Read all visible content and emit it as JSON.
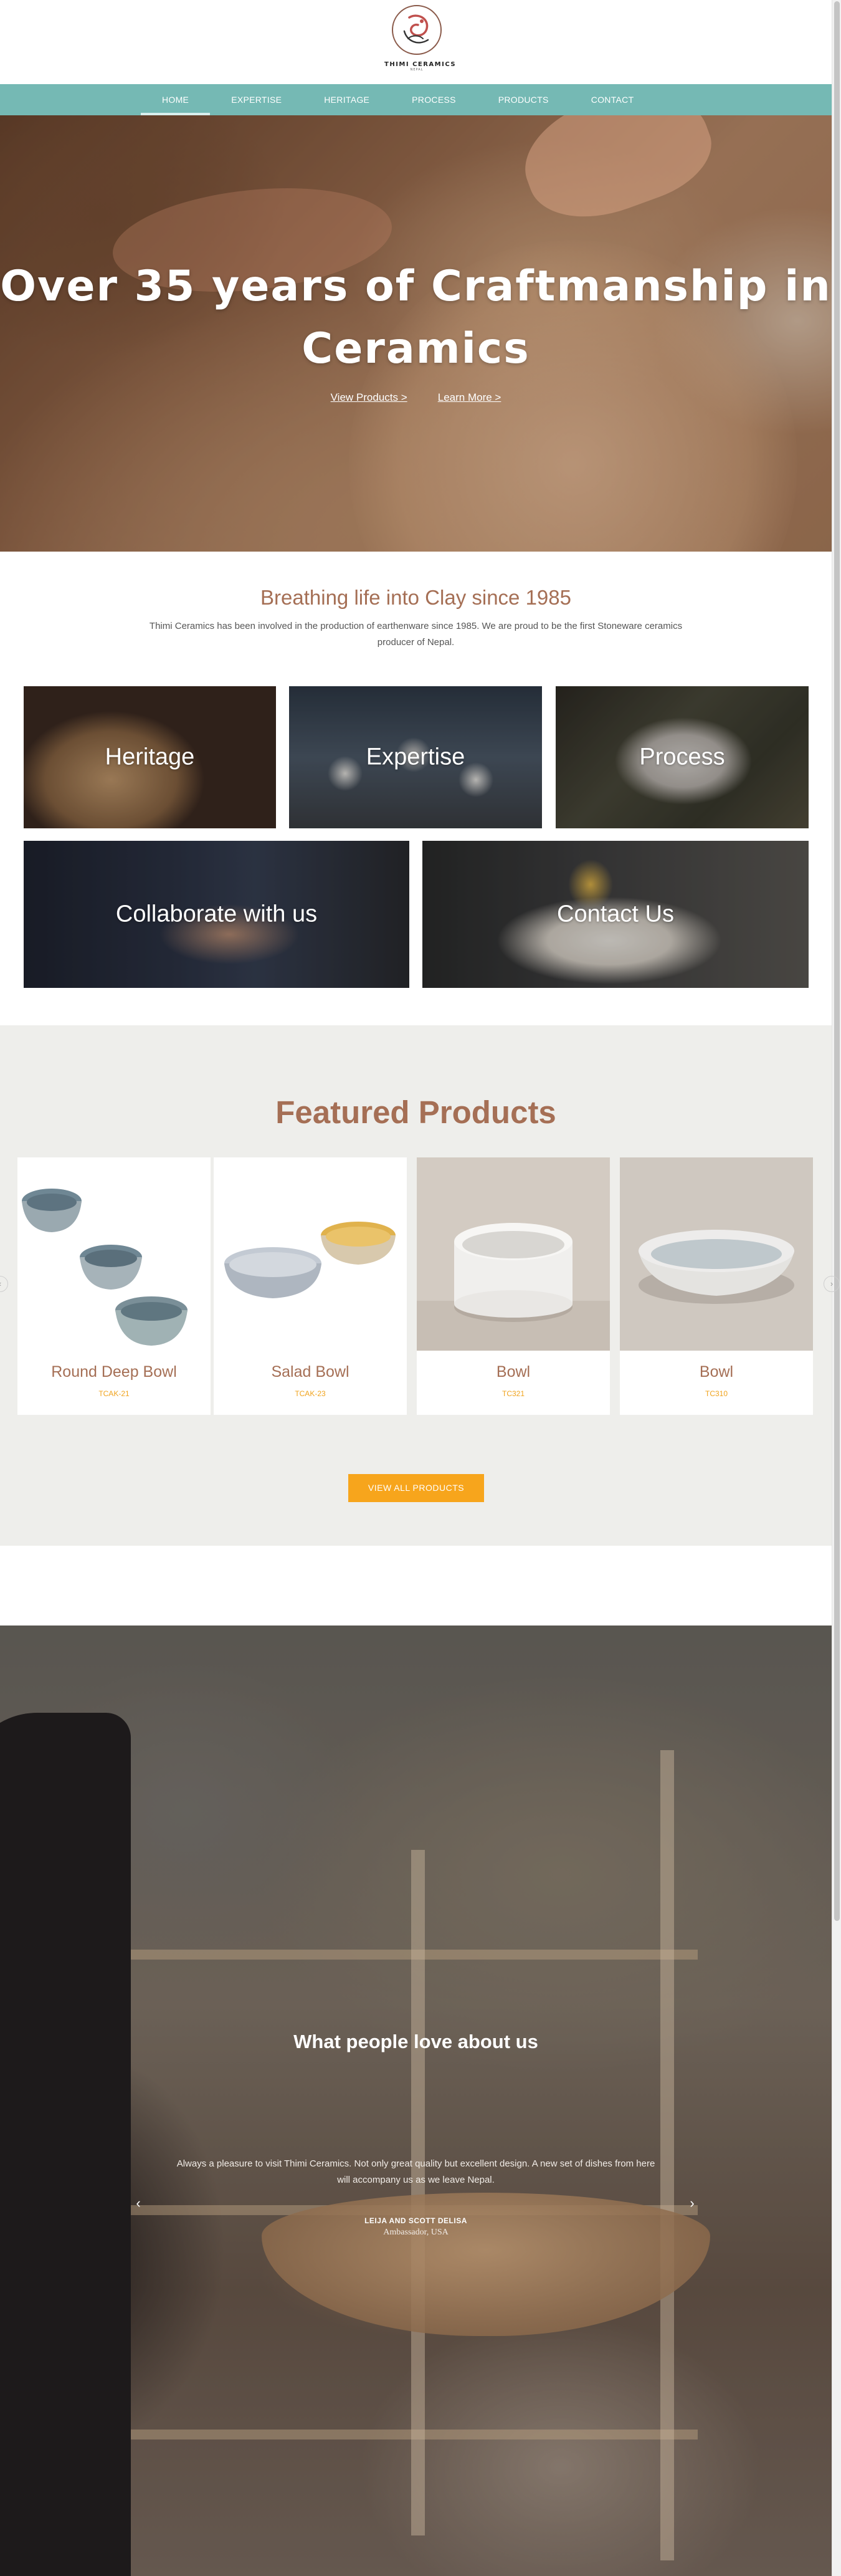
{
  "brand": {
    "name": "THIMI CERAMICS",
    "tagline": "NEPAL"
  },
  "nav": {
    "items": [
      {
        "label": "HOME",
        "active": true
      },
      {
        "label": "EXPERTISE",
        "active": false
      },
      {
        "label": "HERITAGE",
        "active": false
      },
      {
        "label": "PROCESS",
        "active": false
      },
      {
        "label": "PRODUCTS",
        "active": false
      },
      {
        "label": "CONTACT",
        "active": false
      }
    ]
  },
  "hero": {
    "title": "Over 35 years of Craftmanship in Ceramics",
    "link_products": "View Products >",
    "link_learn": "Learn More >"
  },
  "intro": {
    "title": "Breathing life into Clay since 1985",
    "text": "Thimi Ceramics has been involved in the production of earthenware since 1985. We are proud to be the first Stoneware ceramics producer of Nepal."
  },
  "tiles": {
    "heritage": "Heritage",
    "expertise": "Expertise",
    "process": "Process",
    "collaborate": "Collaborate with us",
    "contact": "Contact Us"
  },
  "featured": {
    "title": "Featured Products",
    "products": [
      {
        "name": "Round Deep Bowl",
        "code": "TCAK-21"
      },
      {
        "name": "Salad Bowl",
        "code": "TCAK-23"
      },
      {
        "name": "Bowl",
        "code": "TC321"
      },
      {
        "name": "Bowl",
        "code": "TC310"
      }
    ],
    "button": "VIEW ALL PRODUCTS",
    "prev_icon": "‹",
    "next_icon": "›"
  },
  "testimonial": {
    "title": "What people love about us",
    "quote": "Always a pleasure to visit Thimi Ceramics. Not only great quality but excellent design. A new set of dishes from here will accompany us as we leave Nepal.",
    "author": "LEIJA AND SCOTT DELISA",
    "role": "Ambassador, USA",
    "prev_icon": "‹",
    "next_icon": "›"
  },
  "colors": {
    "nav_bg": "#75b9b4",
    "accent_brown": "#a56f55",
    "accent_orange": "#f7a51c"
  }
}
